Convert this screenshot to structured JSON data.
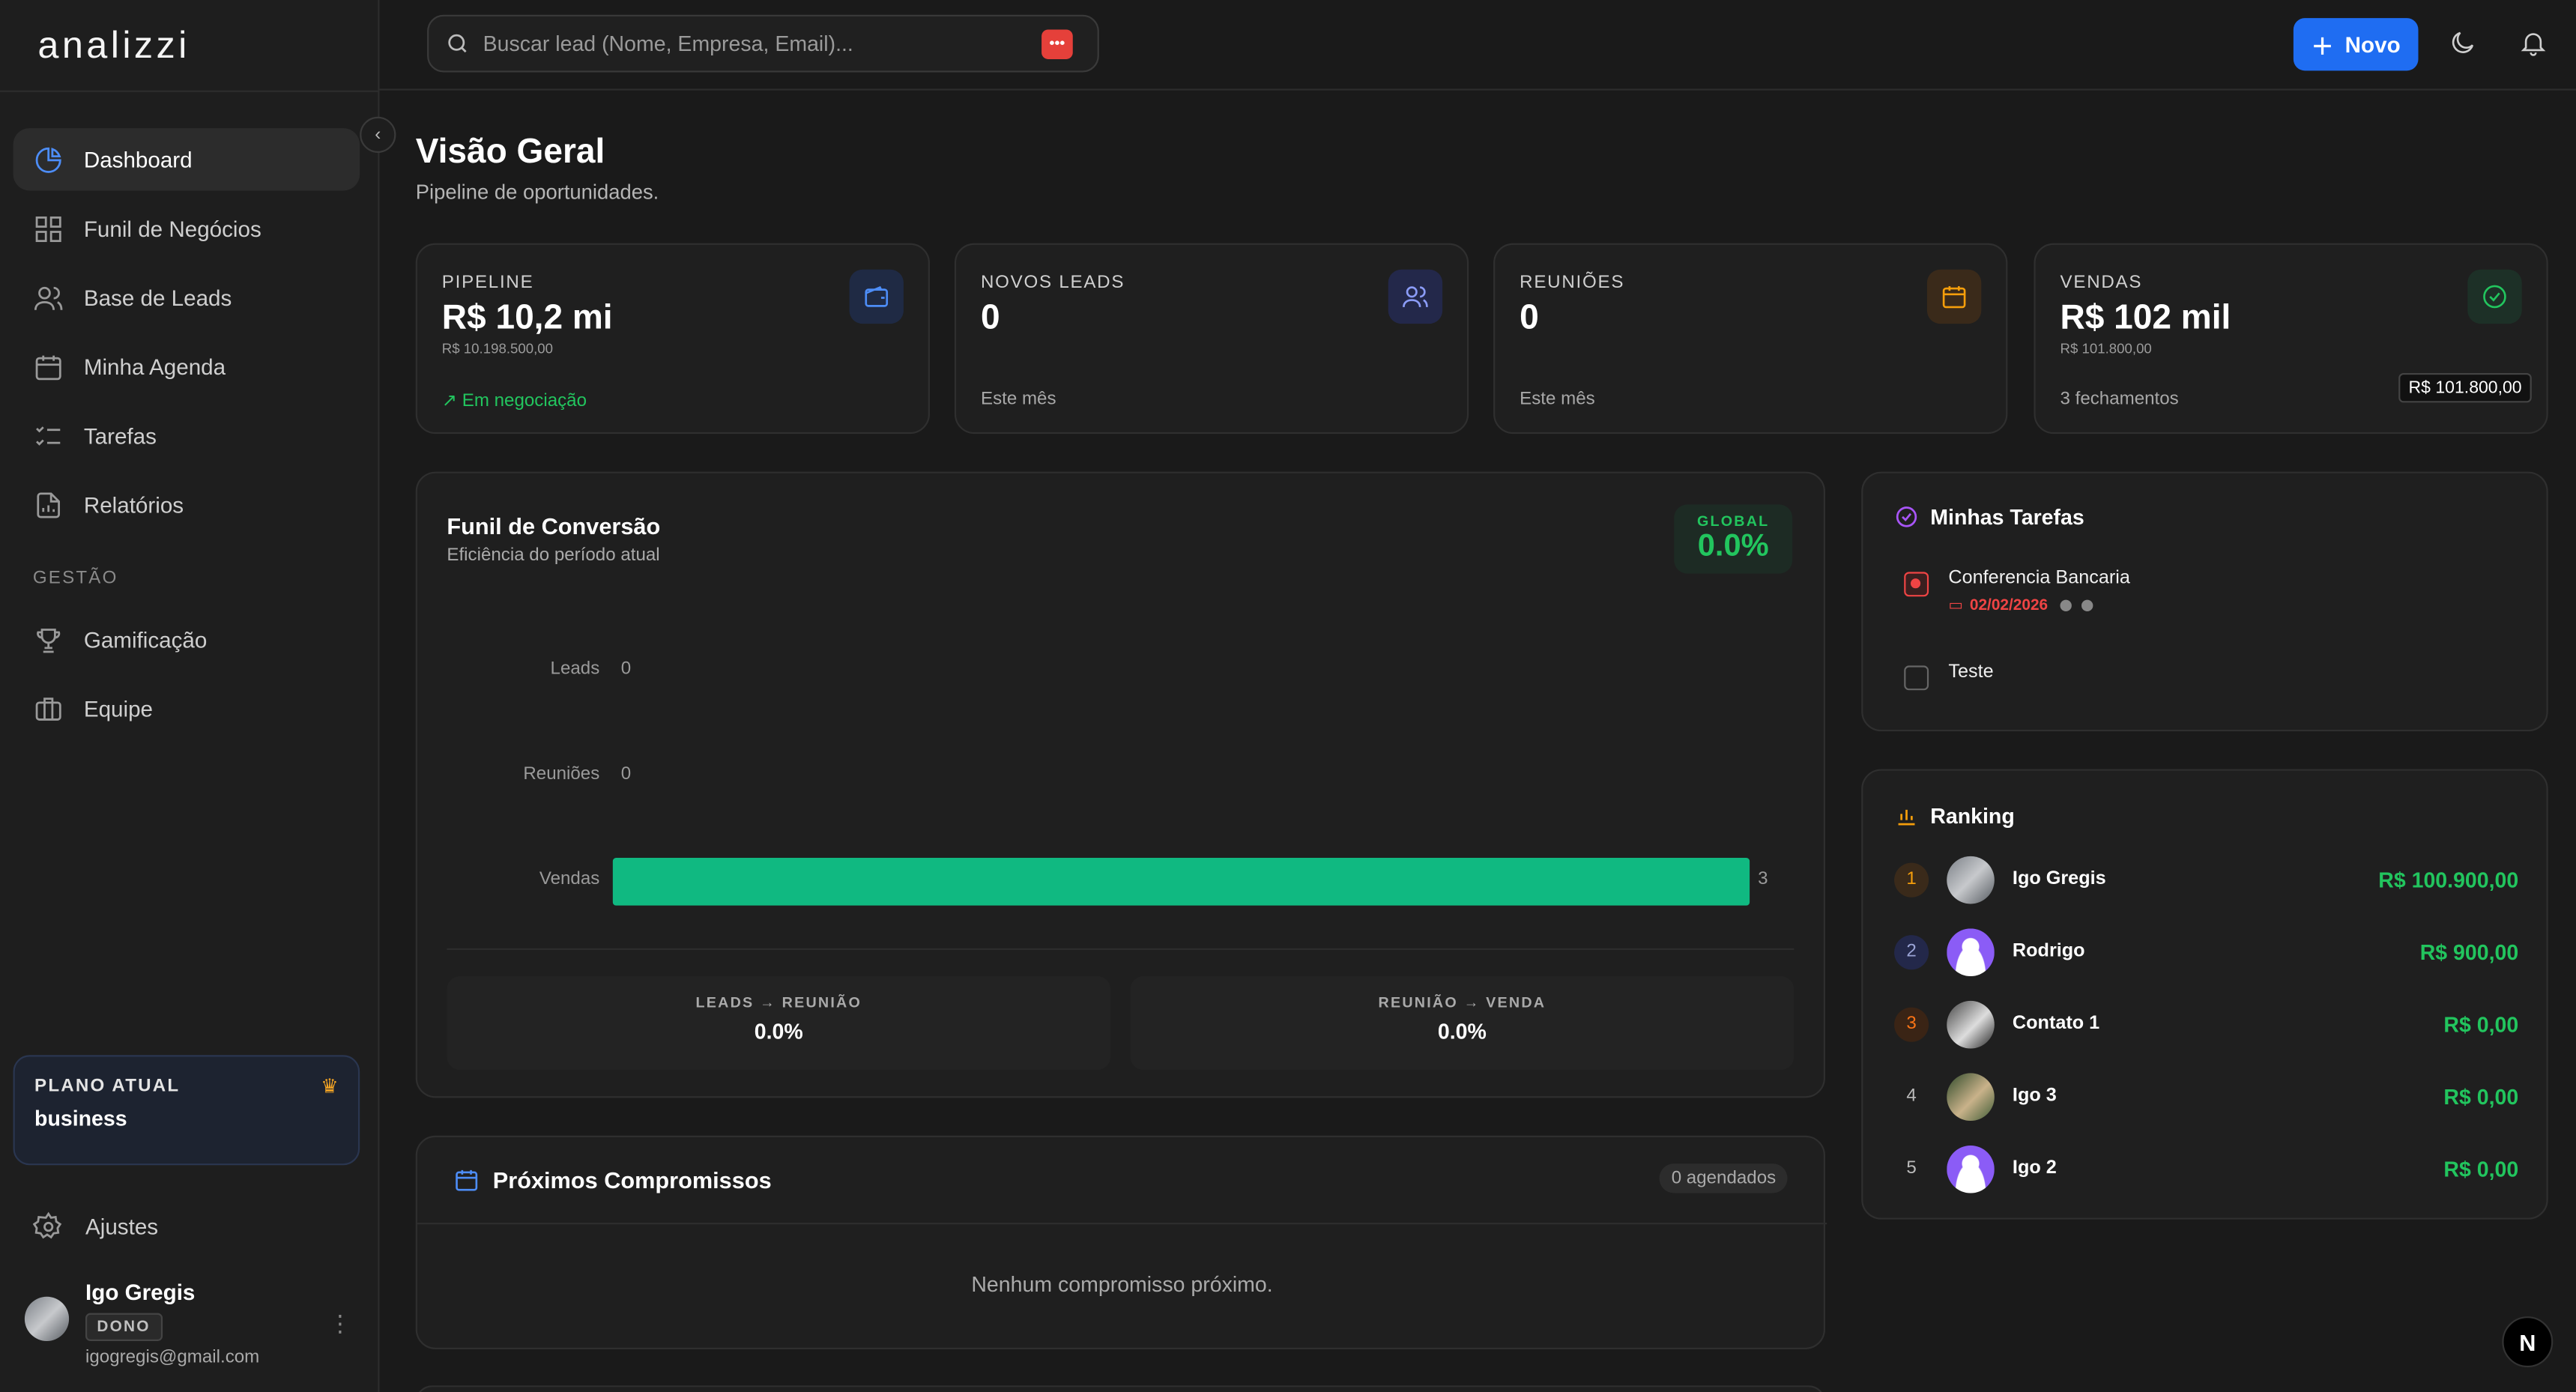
{
  "app": {
    "logo": "analizzi"
  },
  "sidebar": {
    "items": [
      {
        "label": "Dashboard",
        "icon": "pie-chart-icon"
      },
      {
        "label": "Funil de Negócios",
        "icon": "grid-icon"
      },
      {
        "label": "Base de Leads",
        "icon": "users-icon"
      },
      {
        "label": "Minha Agenda",
        "icon": "calendar-icon"
      },
      {
        "label": "Tarefas",
        "icon": "list-checks-icon"
      },
      {
        "label": "Relatórios",
        "icon": "file-chart-icon"
      }
    ],
    "section_label": "GESTÃO",
    "management_items": [
      {
        "label": "Gamificação",
        "icon": "trophy-icon"
      },
      {
        "label": "Equipe",
        "icon": "briefcase-icon"
      }
    ],
    "plan": {
      "title": "PLANO ATUAL",
      "name": "business"
    },
    "settings_label": "Ajustes",
    "user": {
      "name": "Igo Gregis",
      "role": "DONO",
      "email": "igogregis@gmail.com"
    }
  },
  "topbar": {
    "search_placeholder": "Buscar lead (Nome, Empresa, Email)...",
    "new_button": "Novo"
  },
  "header": {
    "title": "Visão Geral",
    "subtitle": "Pipeline de oportunidades."
  },
  "stats": [
    {
      "label": "PIPELINE",
      "value": "R$ 10,2 mi",
      "sub": "R$ 10.198.500,00",
      "foot": "Em negociação",
      "icon": "wallet-icon",
      "color": "#4d8df7"
    },
    {
      "label": "NOVOS LEADS",
      "value": "0",
      "sub": "",
      "foot": "Este mês",
      "icon": "users-icon",
      "color": "#6d7ff7"
    },
    {
      "label": "REUNIÕES",
      "value": "0",
      "sub": "",
      "foot": "Este mês",
      "icon": "calendar-icon",
      "color": "#f59e0b"
    },
    {
      "label": "VENDAS",
      "value": "R$ 102 mil",
      "sub": "R$ 101.800,00",
      "foot": "3 fechamentos",
      "icon": "check-circle-icon",
      "color": "#22c55e",
      "tooltip": "R$ 101.800,00"
    }
  ],
  "funnel": {
    "title": "Funil de Conversão",
    "subtitle": "Eficiência do período atual",
    "global_label": "GLOBAL",
    "global_value": "0.0%",
    "rows": [
      {
        "label": "Leads",
        "value": 0
      },
      {
        "label": "Reuniões",
        "value": 0
      },
      {
        "label": "Vendas",
        "value": 3
      }
    ],
    "rates": [
      {
        "label": "LEADS → REUNIÃO",
        "value": "0.0%"
      },
      {
        "label": "REUNIÃO → VENDA",
        "value": "0.0%"
      }
    ]
  },
  "appointments": {
    "title": "Próximos Compromissos",
    "count": "0 agendados",
    "empty": "Nenhum compromisso próximo."
  },
  "tasks": {
    "title": "Minhas Tarefas",
    "items": [
      {
        "name": "Conferencia Bancaria",
        "date": "02/02/2026",
        "overdue": true
      },
      {
        "name": "Teste",
        "date": "",
        "overdue": false
      }
    ]
  },
  "ranking": {
    "title": "Ranking",
    "rows": [
      {
        "pos": "1",
        "name": "Igo Gregis",
        "value": "R$ 100.900,00"
      },
      {
        "pos": "2",
        "name": "Rodrigo",
        "value": "R$ 900,00"
      },
      {
        "pos": "3",
        "name": "Contato 1",
        "value": "R$ 0,00"
      },
      {
        "pos": "4",
        "name": "Igo 3",
        "value": "R$ 0,00"
      },
      {
        "pos": "5",
        "name": "Igo 2",
        "value": "R$ 0,00"
      }
    ]
  }
}
